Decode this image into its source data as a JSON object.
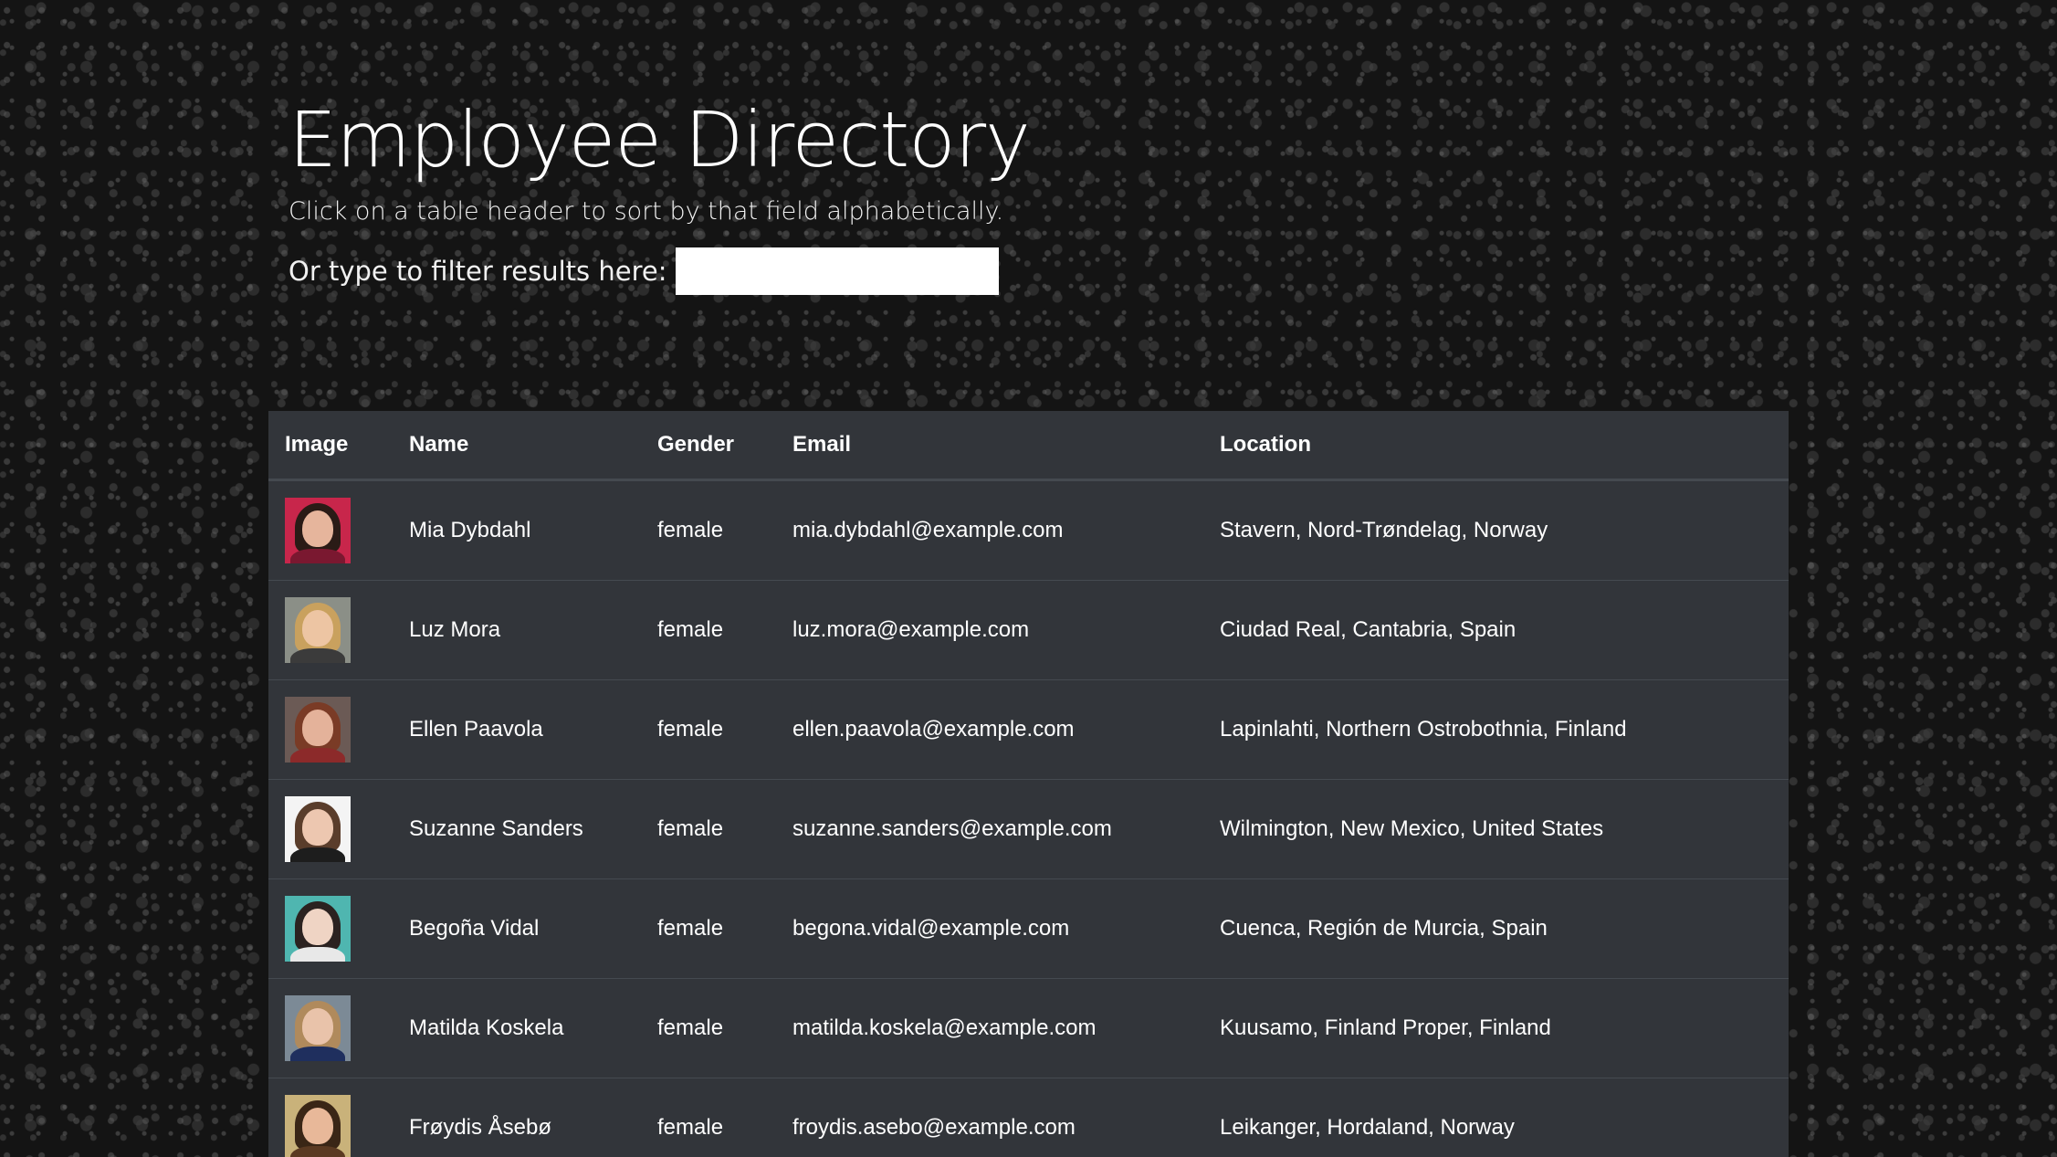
{
  "header": {
    "title": "Employee Directory",
    "subtitle": "Click on a table header to sort by that field alphabetically.",
    "filter_label": "Or type to filter results here:",
    "filter_value": "",
    "filter_placeholder": ""
  },
  "table": {
    "columns": [
      "Image",
      "Name",
      "Gender",
      "Email",
      "Location"
    ],
    "rows": [
      {
        "name": "Mia Dybdahl",
        "gender": "female",
        "email": "mia.dybdahl@example.com",
        "location": "Stavern, Nord-Trøndelag, Norway",
        "avatar": {
          "bg": "#c8264b",
          "hair": "#2a1b16",
          "skin": "#e6b59c",
          "shirt": "#7a1830"
        }
      },
      {
        "name": "Luz Mora",
        "gender": "female",
        "email": "luz.mora@example.com",
        "location": "Ciudad Real, Cantabria, Spain",
        "avatar": {
          "bg": "#8b8f87",
          "hair": "#c9a15e",
          "skin": "#edc5a3",
          "shirt": "#3b3b3b"
        }
      },
      {
        "name": "Ellen Paavola",
        "gender": "female",
        "email": "ellen.paavola@example.com",
        "location": "Lapinlahti, Northern Ostrobothnia, Finland",
        "avatar": {
          "bg": "#6b5a55",
          "hair": "#7a3b26",
          "skin": "#e4b29a",
          "shirt": "#8c2a2a"
        }
      },
      {
        "name": "Suzanne Sanders",
        "gender": "female",
        "email": "suzanne.sanders@example.com",
        "location": "Wilmington, New Mexico, United States",
        "avatar": {
          "bg": "#f4f4f4",
          "hair": "#5a3d2b",
          "skin": "#edc7b0",
          "shirt": "#1d1d1d"
        }
      },
      {
        "name": "Begoña Vidal",
        "gender": "female",
        "email": "begona.vidal@example.com",
        "location": "Cuenca, Región de Murcia, Spain",
        "avatar": {
          "bg": "#4fb6b0",
          "hair": "#2b2220",
          "skin": "#efd4c4",
          "shirt": "#e8e8e8"
        }
      },
      {
        "name": "Matilda Koskela",
        "gender": "female",
        "email": "matilda.koskela@example.com",
        "location": "Kuusamo, Finland Proper, Finland",
        "avatar": {
          "bg": "#7c8a96",
          "hair": "#b08a5c",
          "skin": "#e9c3aa",
          "shirt": "#1f2f5e"
        }
      },
      {
        "name": "Frøydis Åsebø",
        "gender": "female",
        "email": "froydis.asebo@example.com",
        "location": "Leikanger, Hordaland, Norway",
        "avatar": {
          "bg": "#c9b27a",
          "hair": "#3a2616",
          "skin": "#e8b899",
          "shirt": "#5b3a22"
        }
      }
    ]
  },
  "colors": {
    "table_bg": "#32353a",
    "row_border": "#454a50"
  }
}
